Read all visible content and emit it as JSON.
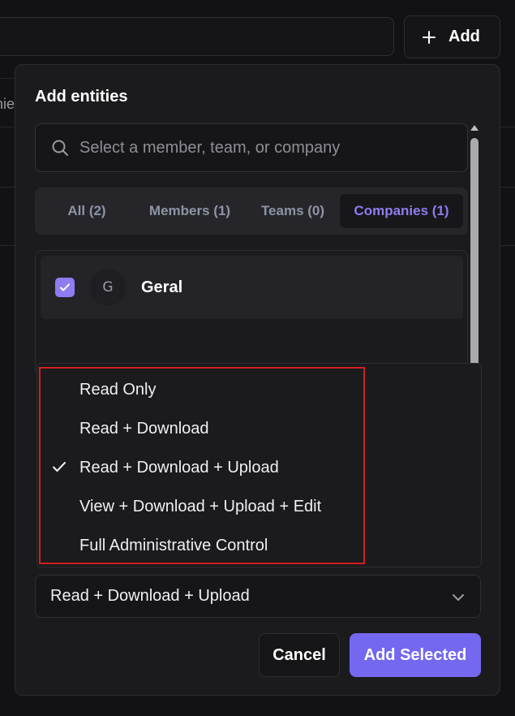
{
  "background": {
    "add_button_label": "Add",
    "tab_fragment": "nie"
  },
  "modal": {
    "title": "Add entities",
    "search": {
      "placeholder": "Select a member, team, or company"
    },
    "tabs": [
      {
        "label": "All (2)",
        "active": false
      },
      {
        "label": "Members (1)",
        "active": false
      },
      {
        "label": "Teams (0)",
        "active": false
      },
      {
        "label": "Companies (1)",
        "active": true
      }
    ],
    "entities": [
      {
        "initial": "G",
        "name": "Geral",
        "checked": true
      }
    ],
    "permission_menu": {
      "items": [
        {
          "label": "Read Only",
          "selected": false
        },
        {
          "label": "Read + Download",
          "selected": false
        },
        {
          "label": "Read + Download + Upload",
          "selected": true
        },
        {
          "label": "View + Download + Upload + Edit",
          "selected": false
        },
        {
          "label": "Full Administrative Control",
          "selected": false
        }
      ]
    },
    "permission_select": {
      "value": "Read + Download + Upload"
    },
    "buttons": {
      "cancel": "Cancel",
      "add_selected": "Add Selected"
    }
  },
  "colors": {
    "accent": "#7468f0",
    "accent_text": "#8f7cf0",
    "highlight_border": "#d0201f"
  }
}
